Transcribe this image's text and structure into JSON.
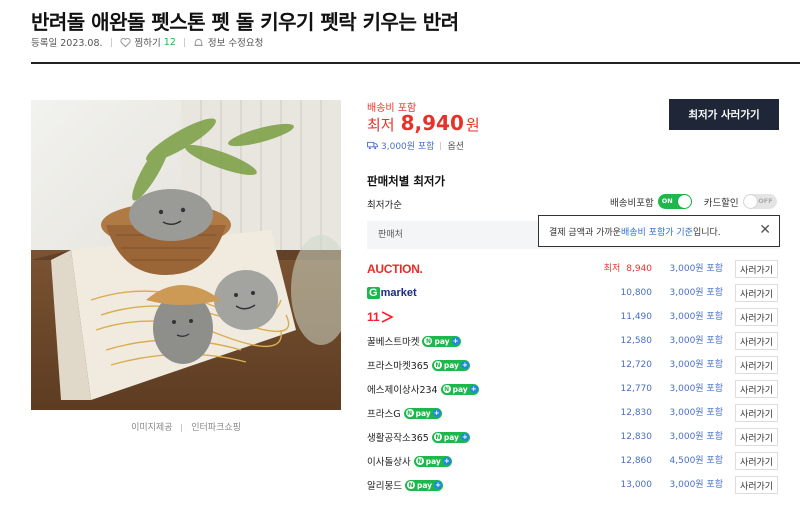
{
  "header": {
    "title": "반려돌 애완돌 펫스톤 펫 돌 키우기 펫락 키우는 반려",
    "reg_date": "등록일 2023.08.",
    "wish_label": "찜하기",
    "wish_count": "12",
    "report_label": "정보 수정요청"
  },
  "image": {
    "caption_left": "이미지제공",
    "caption_right": "인터파크쇼핑"
  },
  "price": {
    "shipping_included": "배송비 포함",
    "lowest_label": "최저",
    "amount": "8,940",
    "currency": "원",
    "shipping_fee": "3,000원 포함",
    "option": "옵션",
    "buy_button": "최저가 사러가기"
  },
  "sellers": {
    "title": "판매처별 최저가",
    "sort": "최저가순",
    "shipping_toggle_label": "배송비포함",
    "shipping_toggle_state": "ON",
    "card_toggle_label": "카드할인",
    "card_toggle_state": "OFF",
    "column_seller": "판매처",
    "tooltip_prefix": "결제 금액과 가까운 ",
    "tooltip_link": "배송비 포함가 기준",
    "tooltip_suffix": "입니다.",
    "lowest_tag": "최저",
    "buy_label": "사러가기",
    "rows": [
      {
        "shop": "AUCTION.",
        "logo": "auction",
        "price": "8,940",
        "ship": "3,000원 포함",
        "npay": false
      },
      {
        "shop": "Gmarket",
        "logo": "gmarket",
        "price": "10,800",
        "ship": "3,000원 포함",
        "npay": false
      },
      {
        "shop": "11번가",
        "logo": "11st",
        "price": "11,490",
        "ship": "3,000원 포함",
        "npay": false
      },
      {
        "shop": "꿀베스트마켓",
        "logo": "",
        "price": "12,580",
        "ship": "3,000원 포함",
        "npay": true
      },
      {
        "shop": "프라스마켓365",
        "logo": "",
        "price": "12,720",
        "ship": "3,000원 포함",
        "npay": true
      },
      {
        "shop": "에스제이상사234",
        "logo": "",
        "price": "12,770",
        "ship": "3,000원 포함",
        "npay": true
      },
      {
        "shop": "프라스G",
        "logo": "",
        "price": "12,830",
        "ship": "3,000원 포함",
        "npay": true
      },
      {
        "shop": "생활공작소365",
        "logo": "",
        "price": "12,830",
        "ship": "3,000원 포함",
        "npay": true
      },
      {
        "shop": "이사돌상사",
        "logo": "",
        "price": "12,860",
        "ship": "4,500원 포함",
        "npay": true
      },
      {
        "shop": "알리몽드",
        "logo": "",
        "price": "13,000",
        "ship": "3,000원 포함",
        "npay": true
      }
    ]
  },
  "colors": {
    "accent_red": "#e5332a",
    "link_blue": "#4a6fc9",
    "npay_green": "#1db84b",
    "button_navy": "#1f2638"
  },
  "icons": {
    "wish": "heart-icon",
    "report": "bell-icon",
    "truck": "truck-icon",
    "close": "close-icon",
    "npay": "npay-icon"
  }
}
